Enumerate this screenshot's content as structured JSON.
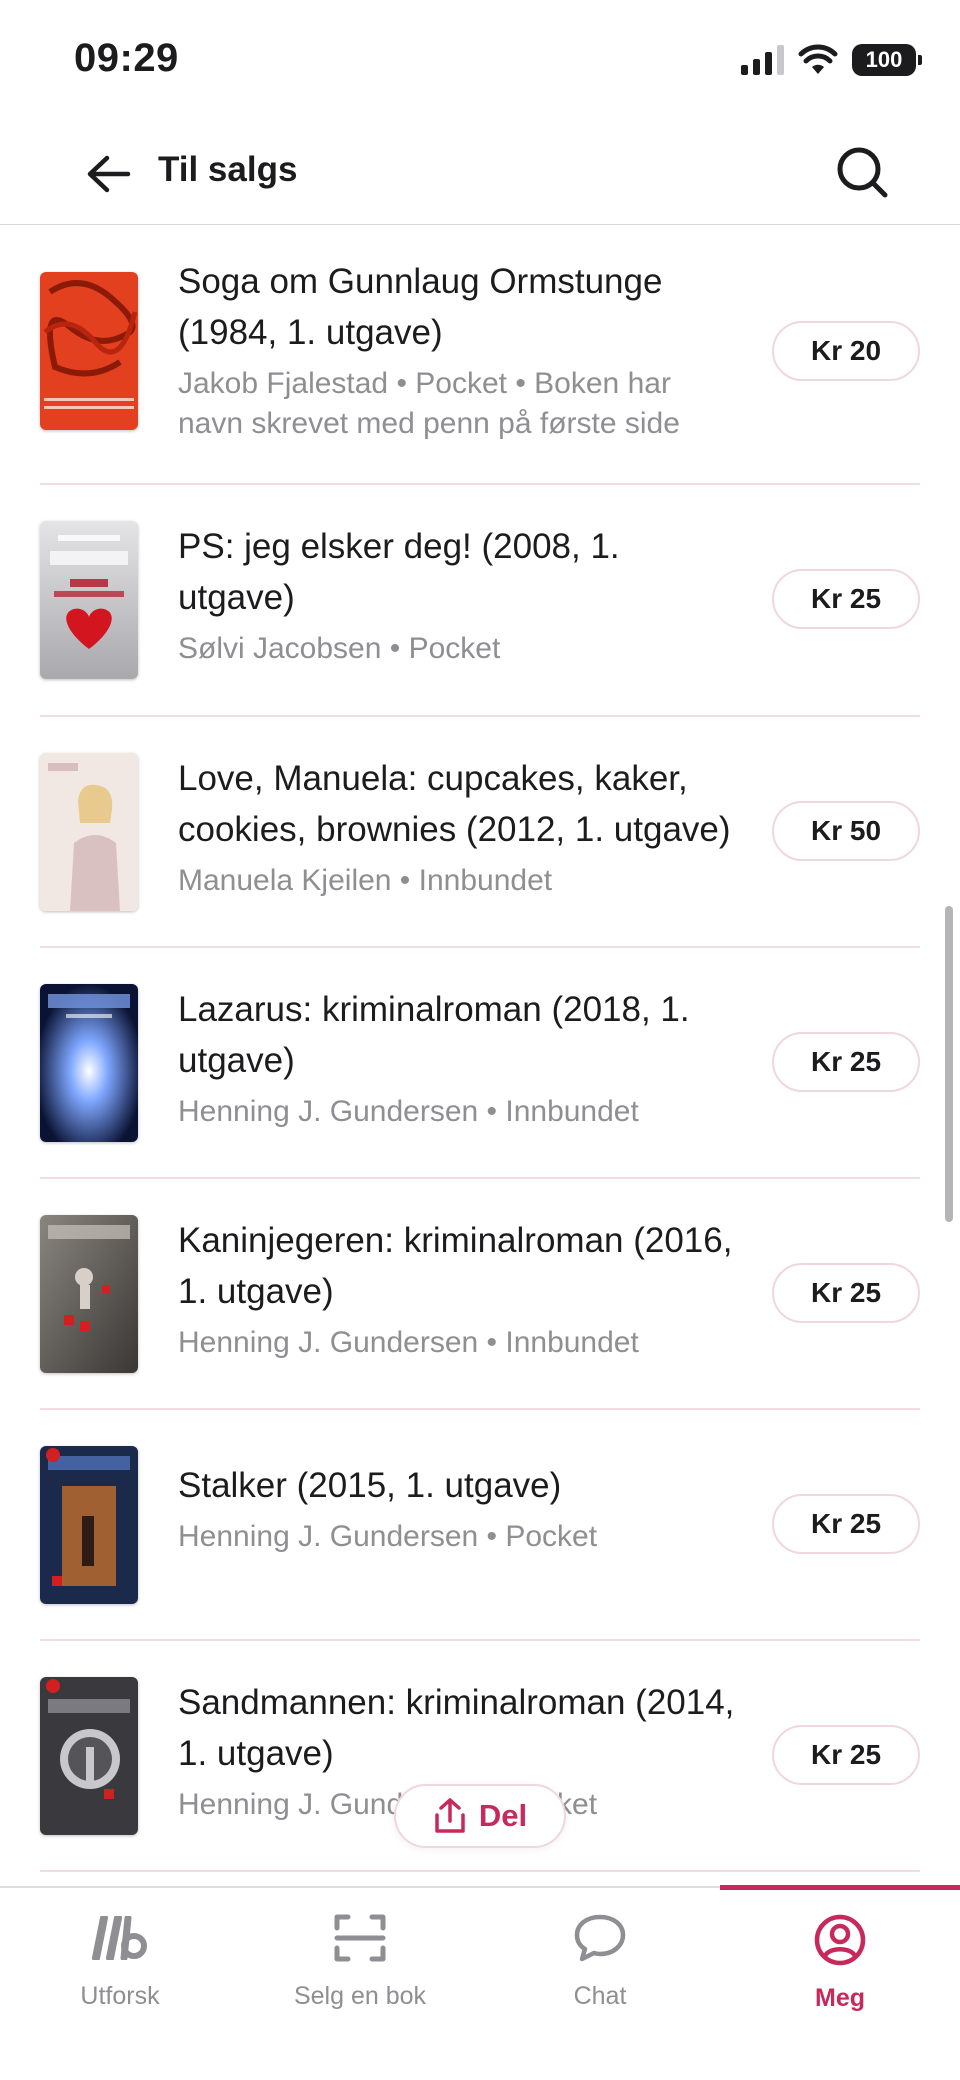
{
  "status_bar": {
    "time": "09:29",
    "battery": "100"
  },
  "header": {
    "title": "Til salgs"
  },
  "books": [
    {
      "title": "Soga om Gunnlaug Ormstunge (1984, 1. utgave)",
      "meta": "Jakob Fjalestad • Pocket • Boken har navn skrevet med penn på første side",
      "price": "Kr 20",
      "cover_colors": [
        "#e2401e",
        "#b8240e"
      ]
    },
    {
      "title": "PS: jeg elsker deg! (2008, 1. utgave)",
      "meta": "Sølvi Jacobsen • Pocket",
      "price": "Kr 25",
      "cover_colors": [
        "#d9d9dc",
        "#9b9ba0"
      ]
    },
    {
      "title": "Love, Manuela: cupcakes, kaker, cookies, brownies (2012, 1. utgave)",
      "meta": "Manuela Kjeilen • Innbundet",
      "price": "Kr 50",
      "cover_colors": [
        "#efe6e2",
        "#c9b3ab"
      ]
    },
    {
      "title": "Lazarus: kriminalroman (2018, 1. utgave)",
      "meta": "Henning J. Gundersen • Innbundet",
      "price": "Kr 25",
      "cover_colors": [
        "#0e1a46",
        "#3d66c8"
      ]
    },
    {
      "title": "Kaninjegeren: kriminalroman (2016, 1. utgave)",
      "meta": "Henning J. Gundersen • Innbundet",
      "price": "Kr 25",
      "cover_colors": [
        "#6e6a66",
        "#3a3734"
      ]
    },
    {
      "title": "Stalker (2015, 1. utgave)",
      "meta": "Henning J. Gundersen • Pocket",
      "price": "Kr 25",
      "cover_colors": [
        "#1b2a4a",
        "#b86a2e"
      ]
    },
    {
      "title": "Sandmannen: kriminalroman (2014, 1. utgave)",
      "meta": "Henning J. Gundersen • Pocket",
      "price": "Kr 25",
      "cover_colors": [
        "#3a3a3e",
        "#c8c8cc"
      ]
    }
  ],
  "share_button": {
    "label": "Del"
  },
  "tabs": [
    {
      "label": "Utforsk",
      "icon": "logo-icon"
    },
    {
      "label": "Selg en bok",
      "icon": "scan-icon"
    },
    {
      "label": "Chat",
      "icon": "chat-bubble-icon"
    },
    {
      "label": "Meg",
      "icon": "profile-icon"
    }
  ],
  "colors": {
    "accent": "#c8295b",
    "divider": "#f2dde3",
    "muted": "#8e8e93"
  }
}
